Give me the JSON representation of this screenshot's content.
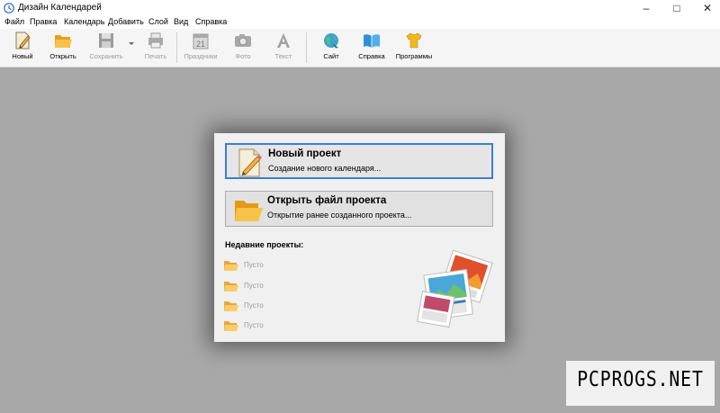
{
  "window": {
    "title": "Дизайн Календарей",
    "controls": {
      "minimize": "–",
      "maximize": "□",
      "close": "✕"
    }
  },
  "menu": [
    "Файл",
    "Правка",
    "Календарь",
    "Добавить",
    "Слой",
    "Вид",
    "Справка"
  ],
  "toolbar": {
    "new": "Новый",
    "open": "Открыть",
    "save": "Сохранить",
    "print": "Печать",
    "holidays": "Праздники",
    "photo": "Фото",
    "text": "Текст",
    "site": "Сайт",
    "help": "Справка",
    "programs": "Программы"
  },
  "dialog": {
    "new_project": {
      "title": "Новый проект",
      "subtitle": "Создание нового календаря..."
    },
    "open_project": {
      "title": "Открыть файл проекта",
      "subtitle": "Открытие ранее созданного проекта..."
    },
    "recent_title": "Недавние проекты:",
    "recent_items": [
      "Пусто",
      "Пусто",
      "Пусто",
      "Пусто"
    ]
  },
  "watermark": "PCPROGS.NET",
  "colors": {
    "workspace": "#a8a8a8",
    "dialog": "#f0f0f0",
    "focus_border": "#3b7fd1",
    "folder": "#f6b73c"
  }
}
